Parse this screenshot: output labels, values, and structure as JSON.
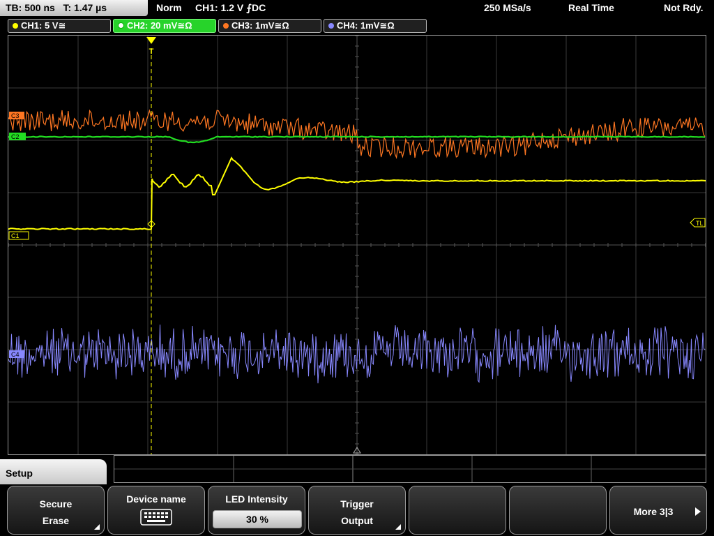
{
  "status": {
    "timebase": "TB: 500 ns",
    "trigger_time": "T: 1.47 µs",
    "mode": "Norm",
    "trigger_info": "CH1: 1.2 V ⨍DC",
    "sample_rate": "250 MSa/s",
    "acq_mode": "Real Time",
    "state": "Not Rdy."
  },
  "channels": [
    {
      "label": "CH1: 5 V≅",
      "color": "#ffff00"
    },
    {
      "label": "CH2: 20 mV≅Ω",
      "color": "#22dd22"
    },
    {
      "label": "CH3: 1mV≅Ω",
      "color": "#ff7722"
    },
    {
      "label": "CH4: 1mV≅Ω",
      "color": "#8888ff"
    }
  ],
  "markers": {
    "c1": "C1",
    "c2": "C2",
    "c3": "C3",
    "c4": "C4",
    "trigger_level": "TL",
    "trigger_pos": "T"
  },
  "menu": {
    "title": "Setup",
    "keys": [
      {
        "line1": "Secure",
        "line2": "Erase"
      },
      {
        "line1": "Device name",
        "icon": "keyboard-icon"
      },
      {
        "line1": "LED Intensity",
        "value": "30 %"
      },
      {
        "line1": "Trigger",
        "line2": "Output"
      },
      {
        "line1": ""
      },
      {
        "line1": ""
      },
      {
        "line1": "More 3|3"
      }
    ]
  }
}
